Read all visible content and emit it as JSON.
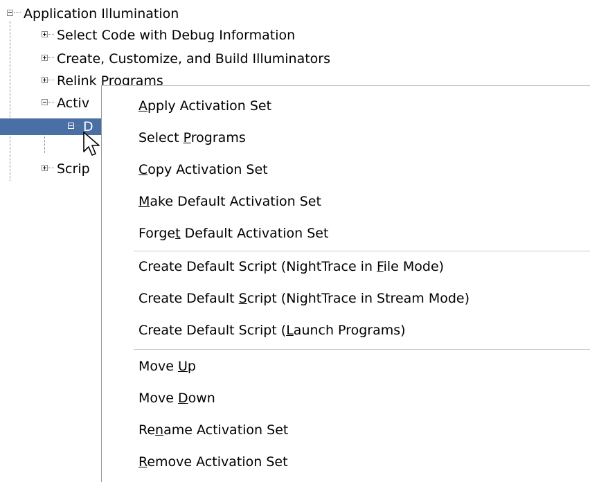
{
  "tree": {
    "root": {
      "label": "Application Illumination",
      "state": "expanded"
    },
    "children": [
      {
        "label": "Select Code with Debug Information",
        "state": "collapsed"
      },
      {
        "label": "Create, Customize, and Build Illuminators",
        "state": "collapsed"
      },
      {
        "label": "Relink Programs",
        "state": "collapsed"
      },
      {
        "label": "Activ",
        "state": "expanded"
      },
      {
        "label": "D",
        "state": "expanded",
        "selected": true
      },
      {
        "label": "Scrip",
        "state": "collapsed"
      }
    ]
  },
  "context_menu": {
    "groups": [
      [
        {
          "label": "Apply Activation Set",
          "mnemonic": "A"
        },
        {
          "label": "Select Programs",
          "mnemonic": "P"
        },
        {
          "label": "Copy Activation Set",
          "mnemonic": "C"
        },
        {
          "label": "Make Default Activation Set",
          "mnemonic": "M"
        },
        {
          "label": "Forget Default Activation Set",
          "mnemonic": "t"
        }
      ],
      [
        {
          "label": "Create Default Script (NightTrace in File Mode)",
          "mnemonic": "F"
        },
        {
          "label": "Create Default Script (NightTrace in Stream Mode)",
          "mnemonic": "S"
        },
        {
          "label": "Create Default Script (Launch Programs)",
          "mnemonic": "L"
        }
      ],
      [
        {
          "label": "Move Up",
          "mnemonic": "U"
        },
        {
          "label": "Move Down",
          "mnemonic": "D"
        },
        {
          "label": "Rename Activation Set",
          "mnemonic": "n"
        },
        {
          "label": "Remove Activation Set",
          "mnemonic": "R"
        }
      ]
    ]
  },
  "colors": {
    "selection": "#4a6fa5",
    "menu_background": "#ffffff",
    "separator": "#c6c6c6"
  },
  "icons": {
    "expand": "plus-box-icon",
    "collapse": "minus-box-icon",
    "cursor": "arrow-pointer-icon"
  }
}
